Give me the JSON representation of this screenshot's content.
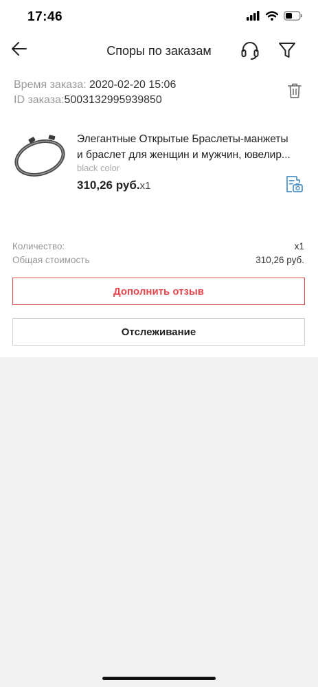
{
  "status_bar": {
    "time": "17:46"
  },
  "header": {
    "title": "Споры по заказам"
  },
  "order": {
    "time_label": "Время заказа:",
    "time_value": "2020-02-20 15:06",
    "id_label": "ID заказа:",
    "id_value": "5003132995939850"
  },
  "product": {
    "title_line1": "Элегантные Открытые Браслеты-манжеты",
    "title_line2": "и браслет для женщин и мужчин, ювелир...",
    "variant": "black color",
    "price": "310,26 руб.",
    "qty": "x1"
  },
  "summary": {
    "qty_label": "Количество:",
    "qty_value": "x1",
    "total_label": "Общая стоимость",
    "total_value": "310,26 руб."
  },
  "actions": {
    "review_label": "Дополнить отзыв",
    "track_label": "Отслеживание"
  },
  "colors": {
    "accent_red": "#e5484d",
    "icon_blue": "#4a90c8",
    "page_bg": "#f2f2f2"
  },
  "icons": [
    "back-arrow-icon",
    "headset-icon",
    "filter-icon",
    "trash-icon",
    "photo-review-icon",
    "signal-icon",
    "wifi-icon",
    "battery-icon"
  ]
}
